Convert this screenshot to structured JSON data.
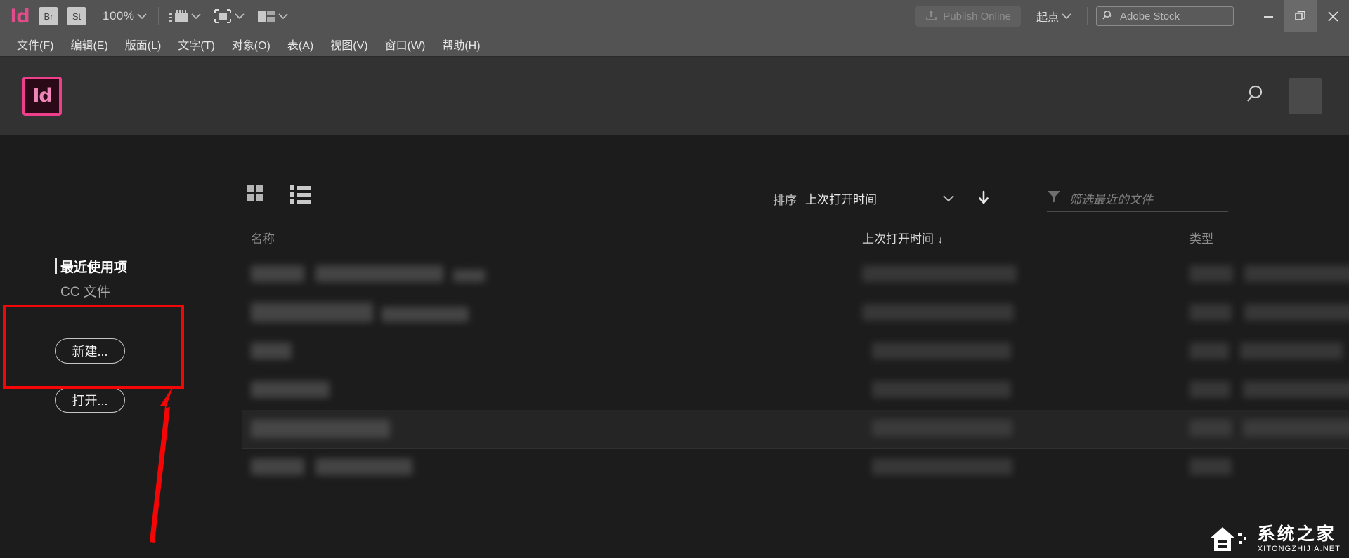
{
  "appbar": {
    "logo": "Id",
    "bridge_label": "Br",
    "stock_label": "St",
    "zoom_level": "100%",
    "icons": {
      "screen_mode": "screen-mode-icon",
      "view_options": "view-options-icon",
      "arrange_documents": "arrange-documents-icon",
      "publish": "publish-upload-icon",
      "stock_search": "stock-search-icon"
    },
    "publish_label": "Publish Online",
    "workspace_label": "起点",
    "stock_placeholder": "Adobe Stock",
    "window_controls": {
      "minimize": "minimize-icon",
      "restore": "restore-icon",
      "close": "close-icon"
    }
  },
  "menubar": {
    "items": [
      {
        "text": "文件(F)",
        "label": "文件",
        "key": "F"
      },
      {
        "text": "编辑(E)",
        "label": "编辑",
        "key": "E"
      },
      {
        "text": "版面(L)",
        "label": "版面",
        "key": "L"
      },
      {
        "text": "文字(T)",
        "label": "文字",
        "key": "T"
      },
      {
        "text": "对象(O)",
        "label": "对象",
        "key": "O"
      },
      {
        "text": "表(A)",
        "label": "表",
        "key": "A"
      },
      {
        "text": "视图(V)",
        "label": "视图",
        "key": "V"
      },
      {
        "text": "窗口(W)",
        "label": "窗口",
        "key": "W"
      },
      {
        "text": "帮助(H)",
        "label": "帮助",
        "key": "H"
      }
    ]
  },
  "home_header": {
    "app_badge": "Id",
    "search_icon": "search-icon",
    "avatar": "user-avatar"
  },
  "toolbar": {
    "grid_view_icon": "grid-view-icon",
    "list_view_icon": "list-view-icon",
    "sort_label": "排序",
    "sort_value": "上次打开时间",
    "sort_chevron": "chevron-down-icon",
    "sort_direction_icon": "sort-descending-arrow-icon",
    "filter_icon": "filter-funnel-icon",
    "filter_placeholder": "筛选最近的文件"
  },
  "sidebar": {
    "items": [
      {
        "label": "最近使用项",
        "active": true
      },
      {
        "label": "CC 文件",
        "active": false
      }
    ],
    "buttons": [
      {
        "label": "新建...",
        "name": "new-document-button"
      },
      {
        "label": "打开...",
        "name": "open-document-button"
      }
    ]
  },
  "annotation": {
    "highlight_color": "#f40606",
    "target": "新建..."
  },
  "table": {
    "columns": [
      {
        "label": "名称",
        "sorted": false
      },
      {
        "label": "上次打开时间",
        "sorted": true,
        "caret": "↓"
      },
      {
        "label": "类型",
        "sorted": false
      }
    ],
    "rows": [
      {
        "redacted": true,
        "selected": false
      },
      {
        "redacted": true,
        "selected": false
      },
      {
        "redacted": true,
        "selected": false
      },
      {
        "redacted": true,
        "selected": false
      },
      {
        "redacted": true,
        "selected": true
      },
      {
        "redacted": true,
        "selected": false
      }
    ]
  },
  "watermark": {
    "cn": "系统之家",
    "en": "XITONGZHIJIA.NET"
  },
  "colors": {
    "accent_pink": "#ef3e8c",
    "annotation_red": "#f40606",
    "chrome": "#535353",
    "canvas": "#1c1c1c",
    "panel": "#323232"
  }
}
